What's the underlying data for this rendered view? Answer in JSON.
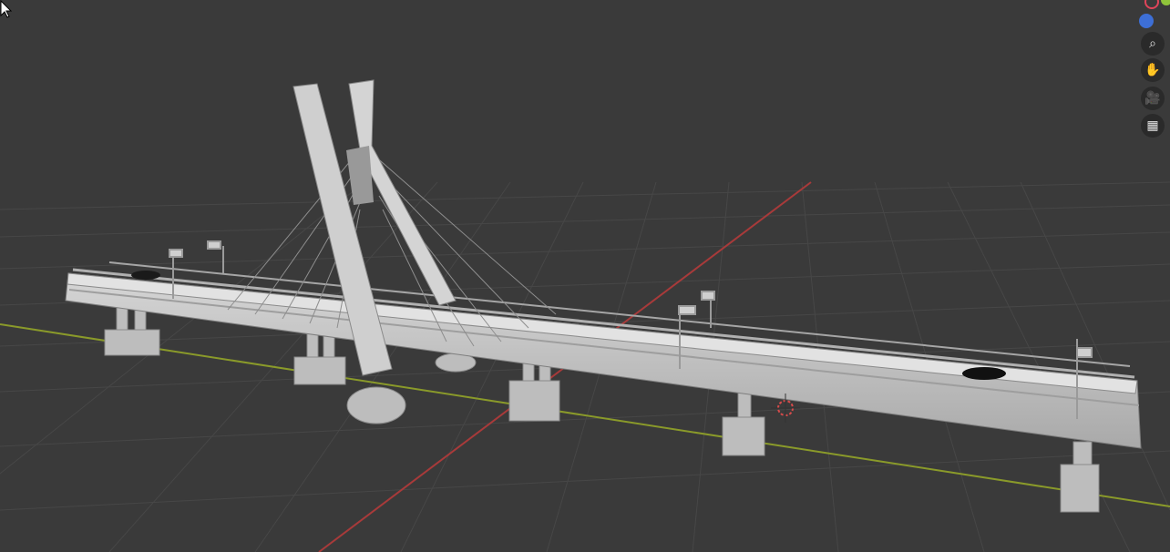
{
  "viewport": {
    "background": "#3a3a3a",
    "grid_color": "#474747",
    "x_axis_color": "#a83a3a",
    "y_axis_color": "#8a9a2a",
    "model_color": "#c8c8c8",
    "cursor_icon": "arrow-pointer"
  },
  "gizmo": {
    "x_axis_color": "#e0455a",
    "y_axis_color": "#8fc43a",
    "z_axis_color": "#3d6fd6"
  },
  "navigation": {
    "zoom": {
      "icon": "magnifier-icon",
      "glyph": "⌕"
    },
    "pan": {
      "icon": "hand-icon",
      "glyph": "✋"
    },
    "camera": {
      "icon": "camera-icon",
      "glyph": "🎥"
    },
    "perspective": {
      "icon": "grid-icon",
      "glyph": "▦"
    }
  }
}
